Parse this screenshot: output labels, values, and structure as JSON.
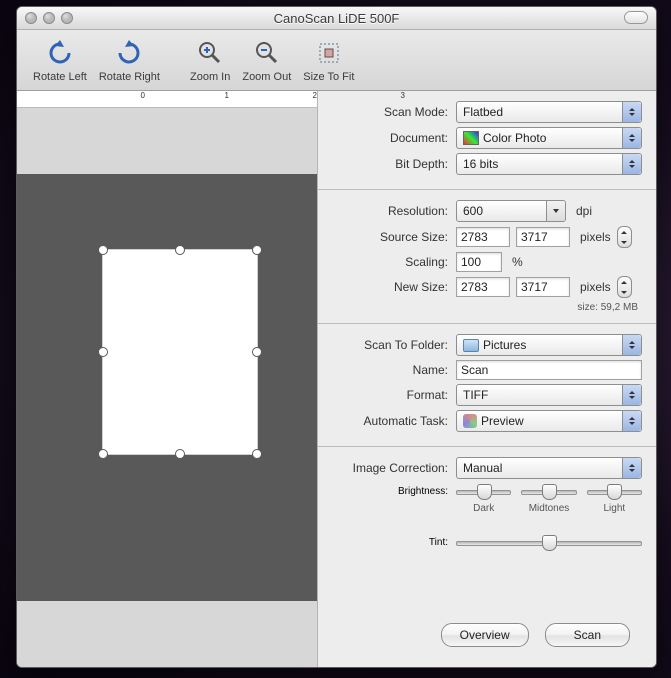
{
  "window": {
    "title": "CanoScan LiDE 500F"
  },
  "toolbar": {
    "rotate_left": "Rotate Left",
    "rotate_right": "Rotate Right",
    "zoom_in": "Zoom In",
    "zoom_out": "Zoom Out",
    "size_to_fit": "Size To Fit"
  },
  "ruler": {
    "0": "0",
    "1": "1",
    "2": "2",
    "3": "3"
  },
  "labels": {
    "scan_mode": "Scan Mode:",
    "document": "Document:",
    "bit_depth": "Bit Depth:",
    "resolution": "Resolution:",
    "source_size": "Source Size:",
    "scaling": "Scaling:",
    "new_size": "New Size:",
    "size_prefix": "size:",
    "scan_to_folder": "Scan To Folder:",
    "name": "Name:",
    "format": "Format:",
    "automatic_task": "Automatic Task:",
    "image_correction": "Image Correction:",
    "brightness": "Brightness:",
    "dark": "Dark",
    "midtones": "Midtones",
    "light": "Light",
    "tint": "Tint:"
  },
  "values": {
    "scan_mode": "Flatbed",
    "document": "Color Photo",
    "bit_depth": "16 bits",
    "resolution": "600",
    "source_w": "2783",
    "source_h": "3717",
    "scaling": "100",
    "new_w": "2783",
    "new_h": "3717",
    "file_size": "59,2 MB",
    "folder": "Pictures",
    "name": "Scan",
    "format": "TIFF",
    "automatic_task": "Preview",
    "image_correction": "Manual"
  },
  "units": {
    "dpi": "dpi",
    "pixels": "pixels",
    "percent": "%"
  },
  "buttons": {
    "overview": "Overview",
    "scan": "Scan"
  }
}
